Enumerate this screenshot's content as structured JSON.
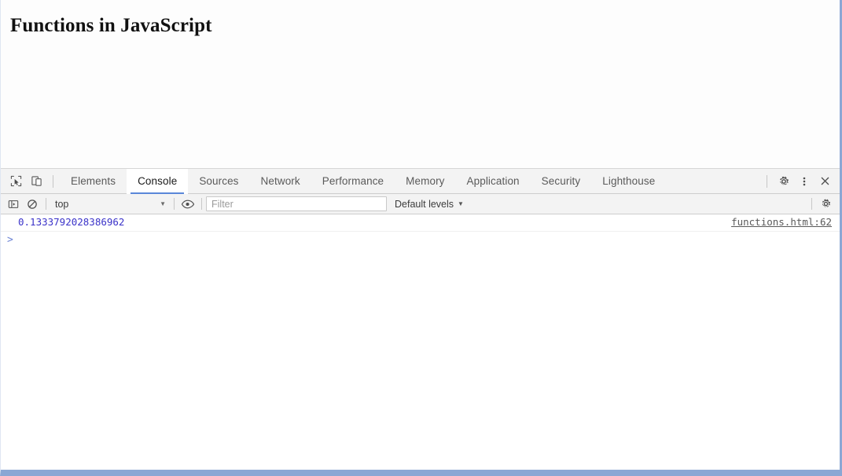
{
  "page": {
    "heading": "Functions in JavaScript"
  },
  "devtools": {
    "left_icons": [
      {
        "name": "inspect-element-icon",
        "label": "Inspect element"
      },
      {
        "name": "device-toolbar-icon",
        "label": "Toggle device toolbar"
      }
    ],
    "tabs": [
      {
        "label": "Elements",
        "active": false
      },
      {
        "label": "Console",
        "active": true
      },
      {
        "label": "Sources",
        "active": false
      },
      {
        "label": "Network",
        "active": false
      },
      {
        "label": "Performance",
        "active": false
      },
      {
        "label": "Memory",
        "active": false
      },
      {
        "label": "Application",
        "active": false
      },
      {
        "label": "Security",
        "active": false
      },
      {
        "label": "Lighthouse",
        "active": false
      }
    ],
    "right_icons": [
      {
        "name": "gear-icon",
        "label": "Settings"
      },
      {
        "name": "kebab-menu-icon",
        "label": "Customize and control DevTools"
      },
      {
        "name": "close-icon",
        "label": "Close DevTools"
      }
    ]
  },
  "console_toolbar": {
    "sidebar_toggle_icon": "console-sidebar-icon",
    "clear_icon": "clear-console-icon",
    "context": {
      "value": "top",
      "caret": "▼"
    },
    "eye_icon": "eye-icon",
    "filter": {
      "value": "",
      "placeholder": "Filter"
    },
    "levels": {
      "label": "Default levels",
      "caret": "▼"
    },
    "settings_icon": "gear-icon"
  },
  "console_output": {
    "messages": [
      {
        "value": "0.1333792028386962",
        "source": "functions.html:62"
      }
    ],
    "prompt": ">",
    "input_value": ""
  },
  "colors": {
    "accent_blue": "#5a87d8",
    "value_blue": "#3b33c9",
    "toolbar_bg": "#f3f3f3",
    "frame_blue": "#8ba7d4"
  }
}
